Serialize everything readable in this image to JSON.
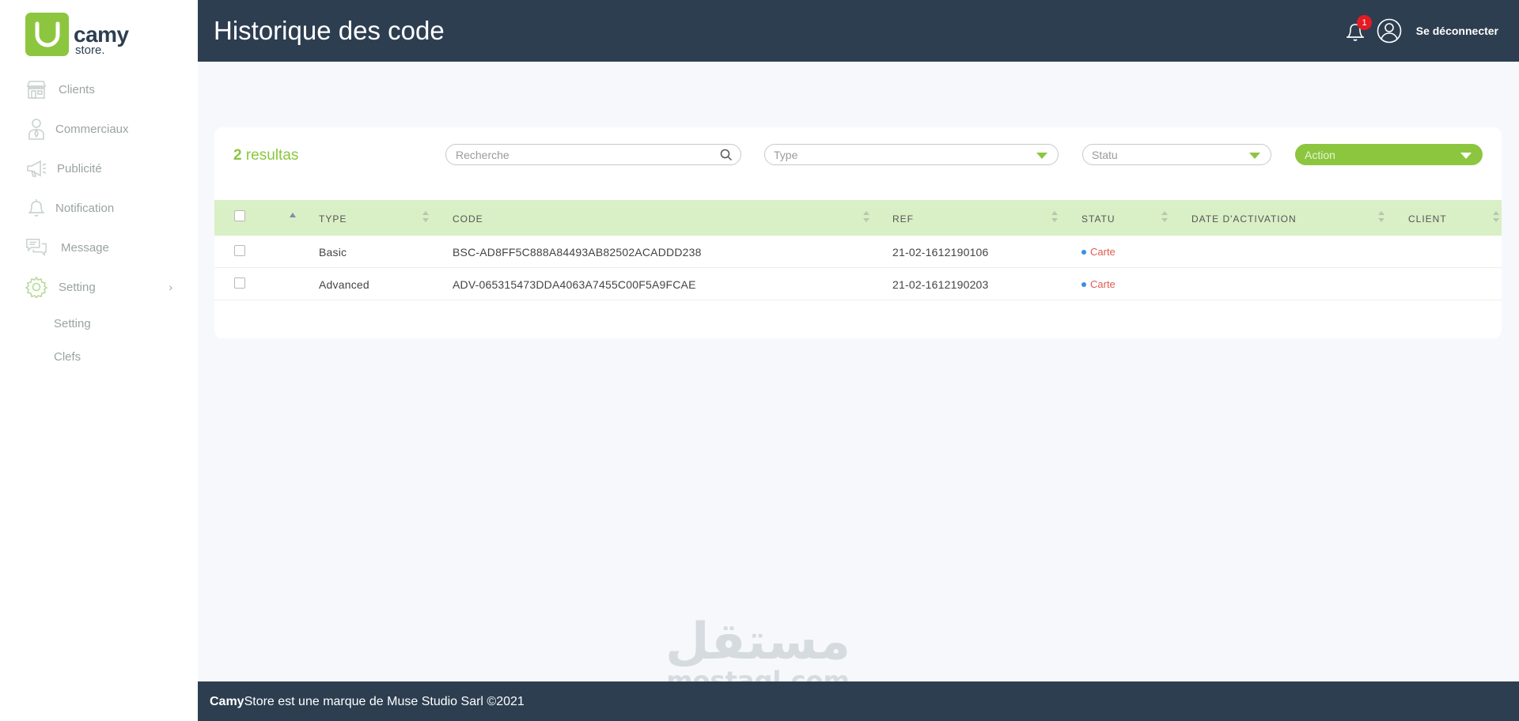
{
  "app": {
    "logo_main": "camy",
    "logo_sub": "store."
  },
  "sidebar": {
    "items": [
      {
        "label": "Clients",
        "icon": "store-icon"
      },
      {
        "label": "Commerciaux",
        "icon": "person-icon"
      },
      {
        "label": "Publicité",
        "icon": "megaphone-icon"
      },
      {
        "label": "Notification",
        "icon": "bell-icon"
      },
      {
        "label": "Message",
        "icon": "chat-icon"
      },
      {
        "label": "Setting",
        "icon": "gear-icon",
        "expandable": true
      }
    ],
    "sub_items": [
      {
        "label": "Setting"
      },
      {
        "label": "Clefs"
      }
    ]
  },
  "header": {
    "title": "Historique des code",
    "notification_count": "1",
    "logout_label": "Se déconnecter"
  },
  "toolbar": {
    "results_count": "2",
    "results_label": "resultas",
    "search_placeholder": "Recherche",
    "type_placeholder": "Type",
    "statu_placeholder": "Statu",
    "action_label": "Action"
  },
  "table": {
    "columns": [
      "TYPE",
      "CODE",
      "REF",
      "STATU",
      "DATE D'ACTIVATION",
      "CLIENT"
    ],
    "rows": [
      {
        "type": "Basic",
        "code": "BSC-AD8FF5C888A84493AB82502ACADDD238",
        "ref": "21-02-1612190106",
        "statu": "Carte",
        "date": "",
        "client": ""
      },
      {
        "type": "Advanced",
        "code": "ADV-065315473DDA4063A7455C00F5A9FCAE",
        "ref": "21-02-1612190203",
        "statu": "Carte",
        "date": "",
        "client": ""
      }
    ]
  },
  "footer": {
    "brand_bold": "Camy",
    "text": "Store est une marque de Muse Studio Sarl ©2021"
  },
  "watermark": {
    "arabic": "مستقل",
    "latin": "mostaql.com"
  },
  "colors": {
    "accent": "#8cc63f",
    "header_bg": "#2d3e50",
    "table_header_bg": "#d9efc6",
    "status_text": "#e05a4e",
    "badge": "#e31b23"
  }
}
